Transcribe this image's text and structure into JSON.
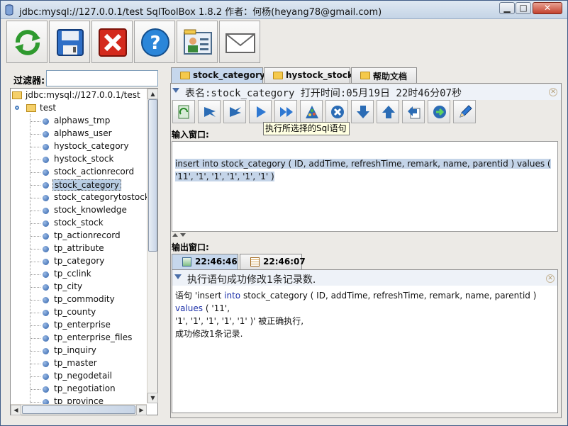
{
  "window": {
    "title": "jdbc:mysql://127.0.0.1/test SqlToolBox 1.8.2 作者：何杨(heyang78@gmail.com)",
    "controls": {
      "minimize": "▁",
      "maximize": "□",
      "close": "✕"
    }
  },
  "toolbar": {
    "buttons": [
      {
        "name": "refresh-button",
        "icon": "refresh-arrows-icon"
      },
      {
        "name": "save-button",
        "icon": "floppy-disk-icon"
      },
      {
        "name": "close-connection-button",
        "icon": "red-x-icon"
      },
      {
        "name": "help-button",
        "icon": "question-mark-icon"
      },
      {
        "name": "contact-button",
        "icon": "contact-card-icon"
      },
      {
        "name": "email-button",
        "icon": "envelope-icon"
      }
    ]
  },
  "filter": {
    "label": "过滤器:",
    "value": ""
  },
  "tree": {
    "root": "jdbc:mysql://127.0.0.1/test",
    "database": "test",
    "tables": [
      "alphaws_tmp",
      "alphaws_user",
      "hystock_category",
      "hystock_stock",
      "stock_actionrecord",
      "stock_category",
      "stock_categorytostock",
      "stock_knowledge",
      "stock_stock",
      "tp_actionrecord",
      "tp_attribute",
      "tp_category",
      "tp_cclink",
      "tp_city",
      "tp_commodity",
      "tp_county",
      "tp_enterprise",
      "tp_enterprise_files",
      "tp_inquiry",
      "tp_master",
      "tp_negodetail",
      "tp_negotiation",
      "tp_province"
    ],
    "selected": "stock_category"
  },
  "tabs": [
    {
      "label": "stock_category",
      "active": true
    },
    {
      "label": "hystock_stock",
      "active": false
    },
    {
      "label": "帮助文档",
      "active": false
    }
  ],
  "editor": {
    "header": "表名:stock_category 打开时间:05月19日 22时46分07秒",
    "tooltip": "执行所选择的Sql语句",
    "input_label": "输入窗口:",
    "sql": "insert into stock_category ( ID, addTime, refreshTime, remark, name, parentid ) values ( '11', '1', '1', '1', '1', '1' )",
    "output_label": "输出窗口:"
  },
  "actions": [
    "refresh-table-icon",
    "first-record-icon",
    "previous-record-icon",
    "execute-icon",
    "execute-all-icon",
    "format-sql-icon",
    "clear-icon",
    "download-icon",
    "upload-icon",
    "export-icon",
    "next-icon",
    "edit-pencil-icon"
  ],
  "result_tabs": [
    {
      "label": "22:46:46",
      "active": true,
      "icon": "table-icon"
    },
    {
      "label": "22:46:07",
      "active": false,
      "icon": "calendar-icon"
    }
  ],
  "output": {
    "header": "执行语句成功修改1条记录数.",
    "line1_pre": "语句 'insert ",
    "line1_kw1": "into",
    "line1_mid": " stock_category ( ID, addTime, refreshTime, remark, name, parentid ) ",
    "line1_kw2": "values",
    "line1_post": " ( '11',",
    "line2": "'1', '1', '1', '1', '1' )' 被正确执行,",
    "line3": "成功修改1条记录."
  }
}
